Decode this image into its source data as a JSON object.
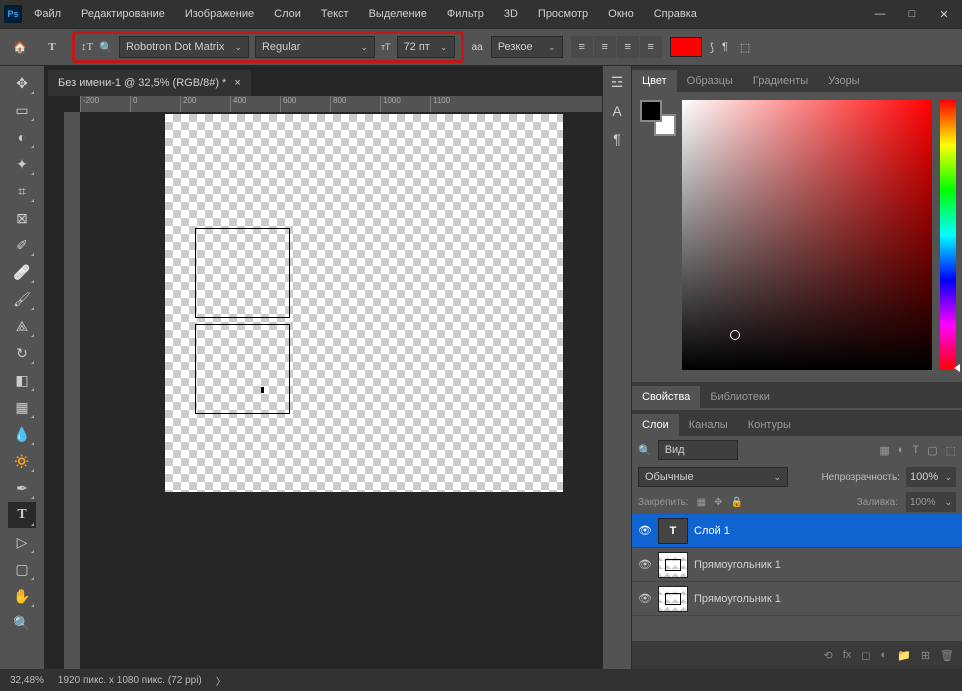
{
  "menu": [
    "Файл",
    "Редактирование",
    "Изображение",
    "Слои",
    "Текст",
    "Выделение",
    "Фильтр",
    "3D",
    "Просмотр",
    "Окно",
    "Справка"
  ],
  "doc": {
    "title": "Без имени-1 @ 32,5% (RGB/8#) *"
  },
  "options": {
    "font": "Robotron Dot Matrix",
    "style": "Regular",
    "size": "72 пт",
    "aa_label": "aa",
    "aa": "Резкое"
  },
  "ruler_marks": [
    "-200",
    "0",
    "200",
    "400",
    "600",
    "800",
    "1000",
    "1100"
  ],
  "panels": {
    "color_tabs": [
      "Цвет",
      "Образцы",
      "Градиенты",
      "Узоры"
    ],
    "color_active": 0,
    "props_tabs": [
      "Свойства",
      "Библиотеки"
    ],
    "layer_tabs": [
      "Слои",
      "Каналы",
      "Контуры"
    ],
    "layer_tabs_active": 0
  },
  "layers": {
    "filter_label": "Вид",
    "blend": "Обычные",
    "opacity_label": "Непрозрачность:",
    "opacity": "100%",
    "lock_label": "Закрепить:",
    "fill_label": "Заливка:",
    "fill": "100%",
    "items": [
      {
        "name": "Слой 1",
        "type": "text",
        "active": true
      },
      {
        "name": "Прямоугольник 1",
        "type": "shape",
        "active": false
      },
      {
        "name": "Прямоугольник 1",
        "type": "shape",
        "active": false
      }
    ]
  },
  "status": {
    "zoom": "32,48%",
    "info": "1920 пикс. x 1080 пикс. (72 ppi)"
  },
  "ps": "Ps"
}
